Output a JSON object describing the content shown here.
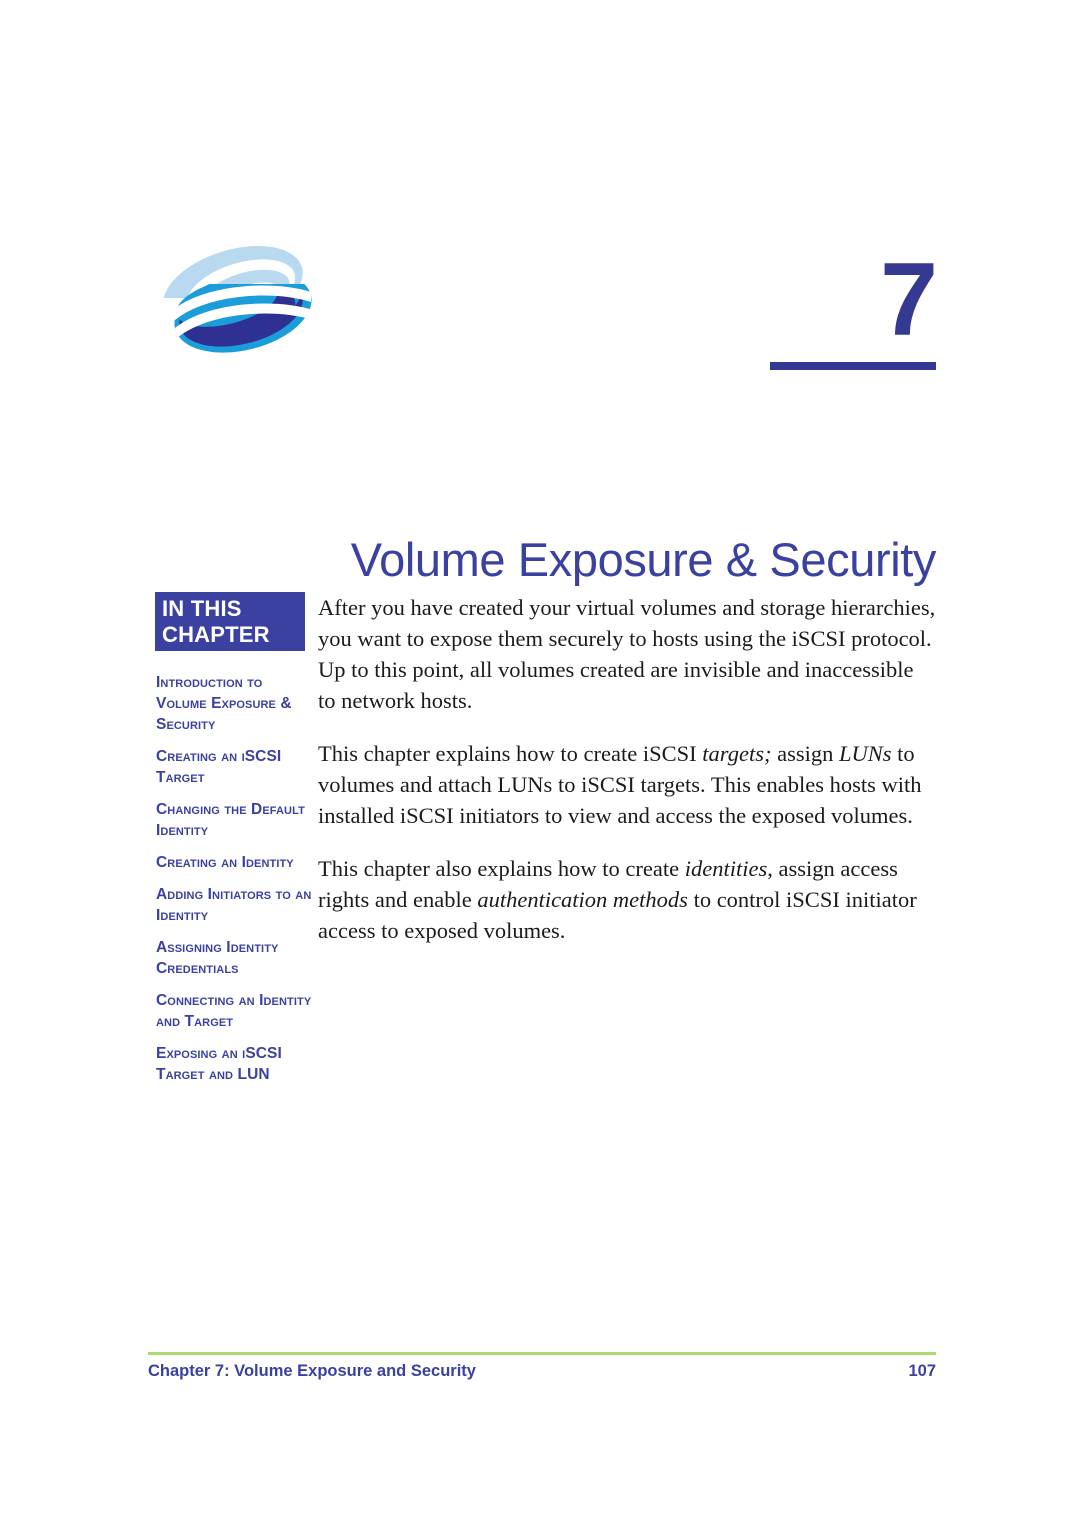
{
  "page": {
    "chapter_number": "7",
    "title": "Volume Exposure & Security",
    "page_number": "107",
    "footer_text": "Chapter 7:  Volume Exposure and Security"
  },
  "colors": {
    "brand_blue": "#3b41a0",
    "chapter_num_blue": "#343a92",
    "footer_rule_green": "#a9dc6c",
    "logo_light_blue": "#b8d9f0",
    "logo_cyan": "#1b9dd9",
    "logo_navy": "#2e3192",
    "body_text": "#1b1b1b",
    "box_text": "#ffffff"
  },
  "sidebar": {
    "heading_line1": "IN THIS",
    "heading_line2": "CHAPTER",
    "items": [
      {
        "label": "Introduction to Volume Exposure & Security"
      },
      {
        "label": "Creating an iSCSI Target"
      },
      {
        "label": "Changing the Default Identity"
      },
      {
        "label": "Creating an Identity"
      },
      {
        "label": "Adding Initiators to an Identity"
      },
      {
        "label": "Assigning Identity Credentials"
      },
      {
        "label": "Connecting an Identity and Target"
      },
      {
        "label": "Exposing an iSCSI Target and LUN"
      }
    ]
  },
  "body": {
    "paragraph_1": "After you have created your virtual volumes and storage hierarchies, you want to expose them securely to hosts using the iSCSI protocol.  Up to this point, all volumes created are invisible and inaccessible to network hosts.",
    "paragraph_2_part1": "This chapter explains how to create iSCSI ",
    "paragraph_2_em1": "targets;",
    "paragraph_2_part2": "  assign ",
    "paragraph_2_em2": "LUNs",
    "paragraph_2_part3": " to volumes and attach LUNs to iSCSI targets.  This enables hosts with installed iSCSI initiators to view and access the exposed volumes.",
    "paragraph_3_part1": "This chapter also explains how to create ",
    "paragraph_3_em1": "identities",
    "paragraph_3_part2": ", assign access rights and enable ",
    "paragraph_3_em2": "authentication methods",
    "paragraph_3_part3": " to control iSCSI initiator access to exposed volumes."
  },
  "logo": {
    "name": "company-swoosh-logo"
  }
}
